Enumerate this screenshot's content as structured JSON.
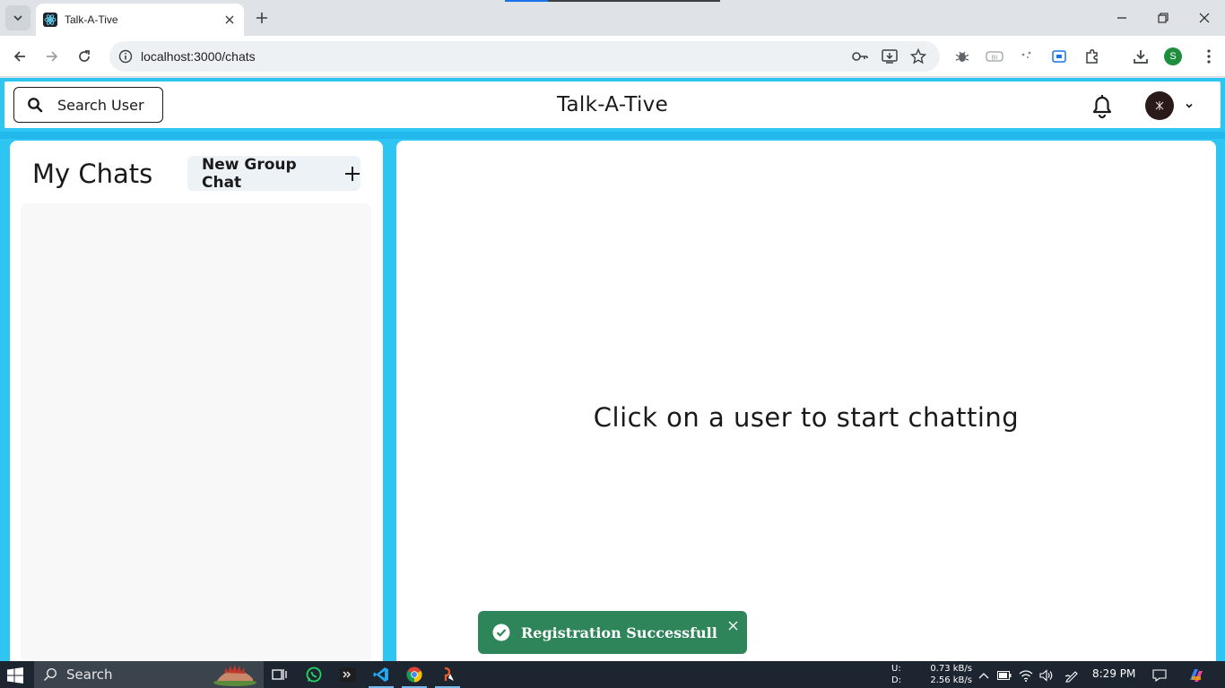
{
  "browser": {
    "tab_title": "Talk-A-Tive",
    "url": "localhost:3000/chats",
    "profile_initial": "S",
    "load_progress": 0.2
  },
  "app": {
    "search_label": "Search User",
    "title": "Talk-A-Tive",
    "my_chats_title": "My Chats",
    "new_group_label": "New Group Chat",
    "placeholder": "Click on a user to start chatting",
    "toast_message": "Registration Successfull",
    "colors": {
      "background": "#2ec5f3",
      "toast": "#2f855a",
      "new_group_bg": "#edf2f7"
    }
  },
  "taskbar": {
    "search_label": "Search",
    "net_up_label": "U:",
    "net_up_value": "0.73 kB/s",
    "net_down_label": "D:",
    "net_down_value": "2.56 kB/s",
    "time": "8:29 PM"
  },
  "icons": [
    "tab-search-icon",
    "react-favicon-icon",
    "close-icon",
    "plus-icon",
    "minimize-icon",
    "restore-icon",
    "back-icon",
    "forward-icon",
    "reload-icon",
    "info-icon",
    "key-icon",
    "install-icon",
    "star-icon",
    "extension-icon",
    "download-icon",
    "more-vert-icon",
    "search-icon",
    "bell-icon",
    "chevron-down-icon",
    "check-circle-icon",
    "windows-icon",
    "task-view-icon",
    "whatsapp-icon",
    "terminal-icon",
    "vscode-icon",
    "chrome-icon",
    "postman-icon",
    "wifi-icon",
    "volume-icon",
    "notification-icon"
  ]
}
